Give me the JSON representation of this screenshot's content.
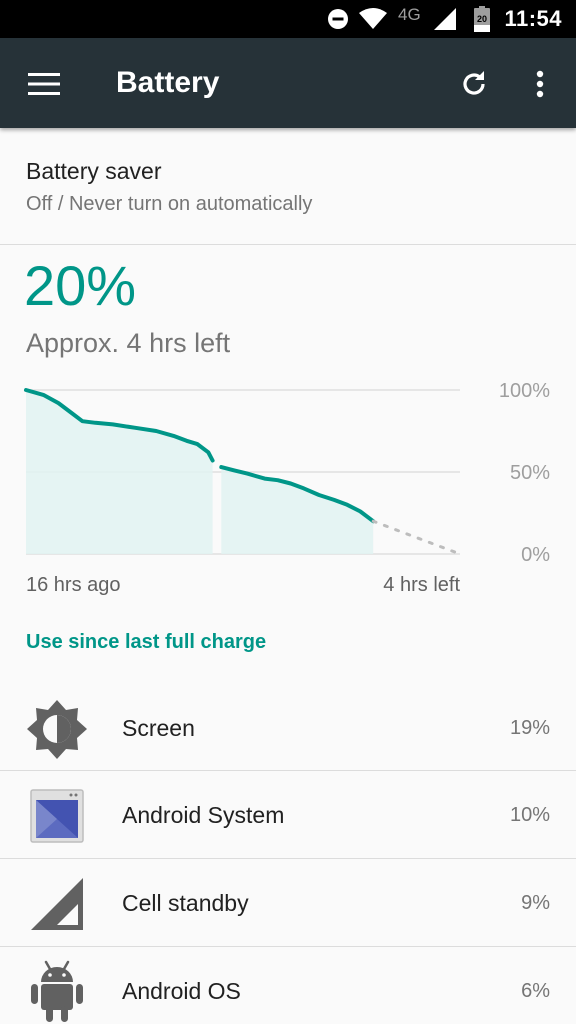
{
  "status_bar": {
    "network_label": "4G",
    "battery_level_text": "20",
    "time": "11:54",
    "icons": [
      "do-not-disturb-icon",
      "wifi-icon",
      "cell-signal-icon",
      "battery-icon"
    ]
  },
  "app_bar": {
    "title": "Battery",
    "icons": [
      "menu-icon",
      "refresh-icon",
      "more-vert-icon"
    ]
  },
  "battery_saver": {
    "title": "Battery saver",
    "subtitle": "Off / Never turn on automatically"
  },
  "battery": {
    "level": "20%",
    "remaining": "Approx. 4 hrs left"
  },
  "chart_data": {
    "type": "area",
    "y_ticks": [
      "100%",
      "50%",
      "0%"
    ],
    "ylim": [
      0,
      100
    ],
    "x_labels": [
      "16 hrs ago",
      "4 hrs left"
    ],
    "xlim": [
      -16,
      4
    ],
    "grid": true,
    "series": [
      {
        "segments": [
          [
            [
              -16,
              100
            ],
            [
              -15.2,
              97
            ],
            [
              -14.5,
              92
            ],
            [
              -13.9,
              86
            ],
            [
              -13.4,
              81
            ],
            [
              -12.8,
              80
            ],
            [
              -12.0,
              79
            ],
            [
              -11.0,
              77
            ],
            [
              -10.0,
              75
            ],
            [
              -9.2,
              72
            ],
            [
              -8.6,
              69
            ],
            [
              -8.1,
              67
            ],
            [
              -7.6,
              62
            ],
            [
              -7.4,
              57
            ]
          ],
          [
            [
              -7.0,
              53
            ],
            [
              -6.4,
              51
            ],
            [
              -5.8,
              49
            ],
            [
              -5.0,
              46
            ],
            [
              -4.4,
              45
            ],
            [
              -3.8,
              43
            ],
            [
              -3.2,
              40
            ],
            [
              -2.5,
              36
            ],
            [
              -1.8,
              33
            ],
            [
              -1.2,
              30
            ],
            [
              -0.6,
              26
            ],
            [
              0,
              20
            ]
          ]
        ],
        "projection": [
          [
            0,
            20
          ],
          [
            4,
            0
          ]
        ]
      }
    ],
    "colors": {
      "line": "#009688",
      "fill": "#e0f2f1",
      "projection": "#bdbdbd",
      "grid": "#e0e0e0"
    }
  },
  "usage": {
    "header": "Use since last full charge",
    "items": [
      {
        "label": "Screen",
        "percent": "19%",
        "icon": "brightness-icon"
      },
      {
        "label": "Android System",
        "percent": "10%",
        "icon": "android-system-icon"
      },
      {
        "label": "Cell standby",
        "percent": "9%",
        "icon": "cell-standby-icon"
      },
      {
        "label": "Android OS",
        "percent": "6%",
        "icon": "android-robot-icon"
      }
    ]
  },
  "colors": {
    "accent": "#009688",
    "app_bar": "#263238",
    "status_bar": "#000000",
    "background": "#fafafa"
  }
}
